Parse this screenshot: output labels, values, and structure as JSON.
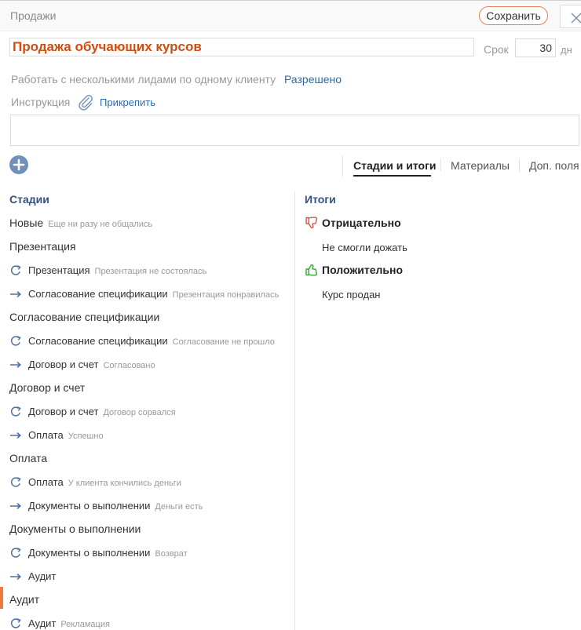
{
  "header": {
    "breadcrumb": "Продажи",
    "save_label": "Сохранить"
  },
  "process": {
    "title": "Продажа обучающих курсов",
    "term_label": "Срок",
    "term_value": "30",
    "term_unit": "дн"
  },
  "settings": {
    "multiple_leads_label": "Работать с несколькими лидами по одному клиенту",
    "multiple_leads_value": "Разрешено",
    "instruction_label": "Инструкция",
    "attach_label": "Прикрепить"
  },
  "tabs": [
    {
      "label": "Стадии и итоги",
      "active": true
    },
    {
      "label": "Материалы",
      "active": false
    },
    {
      "label": "Доп. поля",
      "active": false
    }
  ],
  "stages_title": "Стадии",
  "results_title": "Итоги",
  "stages": [
    {
      "type": "stage",
      "name": "Новые",
      "hint": "Еще ни разу не общались"
    },
    {
      "type": "stage",
      "name": "Презентация",
      "hint": ""
    },
    {
      "type": "loop",
      "name": "Презентация",
      "hint": "Презентация не состоялась"
    },
    {
      "type": "next",
      "name": "Согласование спецификации",
      "hint": "Презентация понравилась"
    },
    {
      "type": "stage",
      "name": "Согласование спецификации",
      "hint": ""
    },
    {
      "type": "loop",
      "name": "Согласование спецификации",
      "hint": "Согласование не прошло"
    },
    {
      "type": "next",
      "name": "Договор и счет",
      "hint": "Согласовано"
    },
    {
      "type": "stage",
      "name": "Договор и счет",
      "hint": ""
    },
    {
      "type": "loop",
      "name": "Договор и счет",
      "hint": "Договор сорвался"
    },
    {
      "type": "next",
      "name": "Оплата",
      "hint": "Успешно"
    },
    {
      "type": "stage",
      "name": "Оплата",
      "hint": ""
    },
    {
      "type": "loop",
      "name": "Оплата",
      "hint": "У клиента кончились деньги"
    },
    {
      "type": "next",
      "name": "Документы о выполнении",
      "hint": "Деньги есть"
    },
    {
      "type": "stage",
      "name": "Документы о выполнении",
      "hint": ""
    },
    {
      "type": "loop",
      "name": "Документы о выполнении",
      "hint": "Возврат"
    },
    {
      "type": "next",
      "name": "Аудит",
      "hint": ""
    },
    {
      "type": "stage",
      "name": "Аудит",
      "hint": "",
      "active": true
    },
    {
      "type": "loop",
      "name": "Аудит",
      "hint": "Рекламация"
    }
  ],
  "results": [
    {
      "label": "Отрицательно",
      "icon": "thumbs-down-icon",
      "color": "#d9534f",
      "items": [
        "Не смогли дожать"
      ]
    },
    {
      "label": "Положительно",
      "icon": "thumbs-up-icon",
      "color": "#3ba03b",
      "items": [
        "Курс продан"
      ]
    }
  ],
  "colors": {
    "accent": "#e3825a",
    "title": "#d24b0f",
    "link": "#2d6aa8",
    "section": "#34527f",
    "active_marker": "#ef7b3c"
  }
}
